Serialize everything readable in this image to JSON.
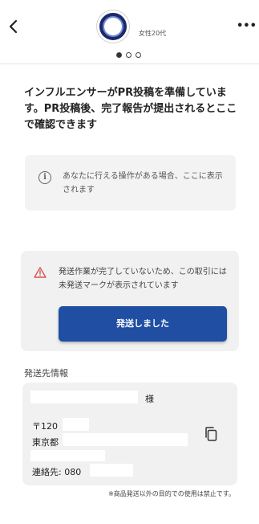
{
  "header": {
    "profile_sub": "女性20代",
    "pager": {
      "count": 3,
      "active": 1
    },
    "more_label": "•••"
  },
  "main": {
    "message": "インフルエンサーがPR投稿を準備しています。PR投稿後、完了報告が提出されるとここで確認できます"
  },
  "info": {
    "text": "あなたに行える操作がある場合、ここに表示されます"
  },
  "warning": {
    "text": "発送作業が完了していないため、この取引には未発送マークが表示されています",
    "button_label": "発送しました"
  },
  "shipping": {
    "section_label": "発送先情報",
    "name_suffix": "様",
    "postal_prefix": "〒120",
    "prefecture": "東京都",
    "contact_prefix": "連絡先: 080",
    "notice": "※商品発送以外の目的での使用は禁止です。"
  },
  "colors": {
    "primary_button": "#1f4ea3",
    "warning_icon": "#d9534f",
    "panel_bg": "#f1f1f1"
  }
}
